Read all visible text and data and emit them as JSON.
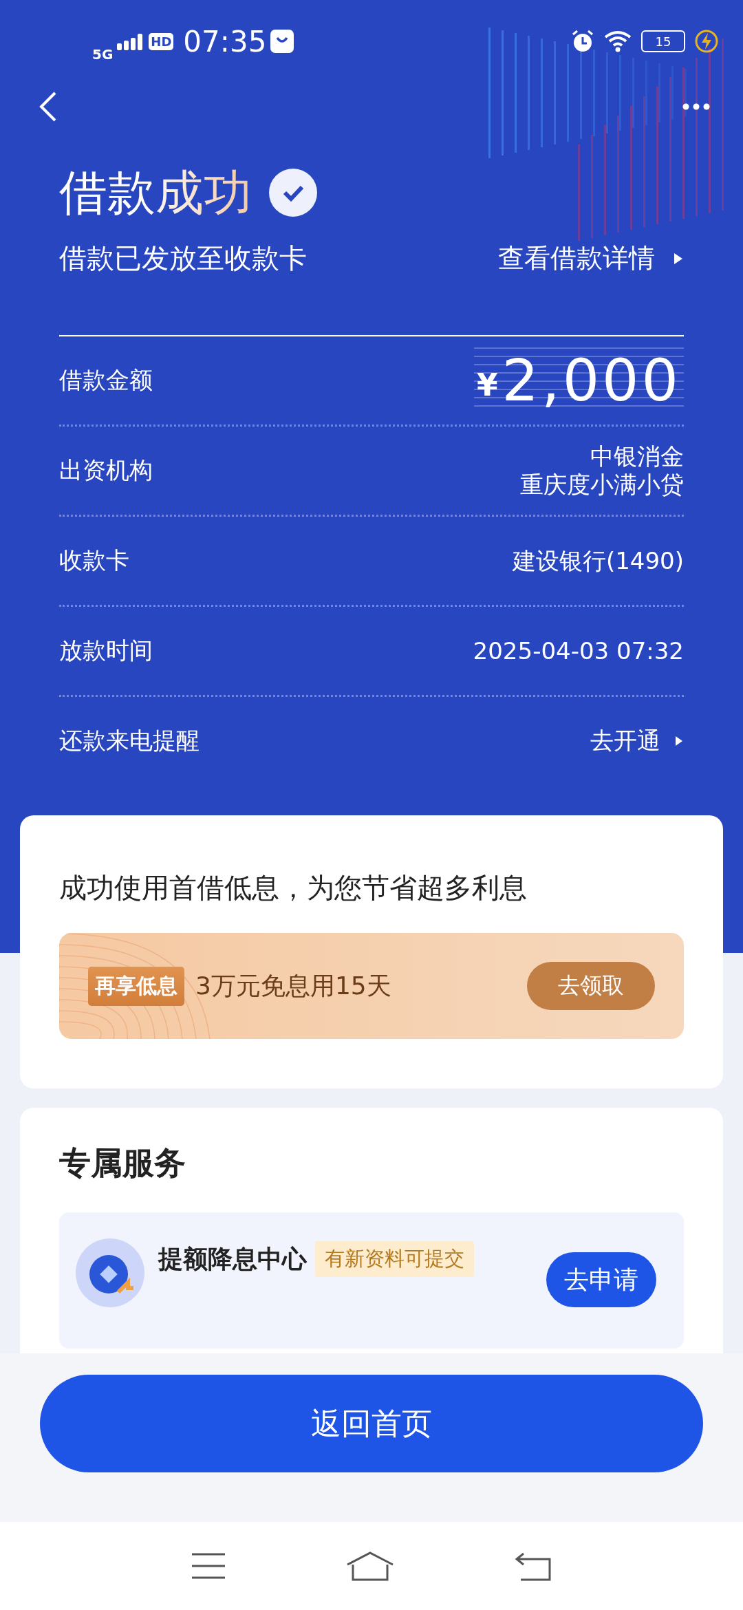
{
  "status_bar": {
    "network": "5G",
    "hd": "HD",
    "time": "07:35",
    "battery": "15"
  },
  "header": {
    "title": "借款成功",
    "subtitle": "借款已发放至收款卡",
    "details_link": "查看借款详情"
  },
  "rows": [
    {
      "kind": "amount",
      "label": "借款金额",
      "currency": "¥",
      "lines": [
        "2,000"
      ]
    },
    {
      "kind": "text",
      "label": "出资机构",
      "lines": [
        "中银消金",
        "重庆度小满小贷"
      ]
    },
    {
      "kind": "text",
      "label": "收款卡",
      "lines": [
        "建设银行(1490)"
      ]
    },
    {
      "kind": "text",
      "label": "放款时间",
      "lines": [
        "2025-04-03 07:32"
      ]
    },
    {
      "kind": "link",
      "label": "还款来电提醒",
      "lines": [
        "去开通"
      ]
    }
  ],
  "promo_card": {
    "headline": "成功使用首借低息，为您节省超多利息",
    "tag": "再享低息",
    "offer": "3万元免息用15天",
    "button": "去领取"
  },
  "services": {
    "title": "专属服务",
    "items": [
      {
        "name": "提额降息中心",
        "badge": "有新资料可提交",
        "button": "去申请"
      }
    ]
  },
  "home_button": "返回首页"
}
